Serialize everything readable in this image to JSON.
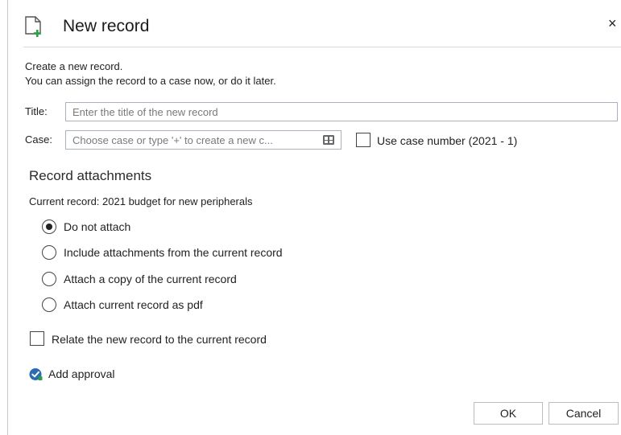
{
  "dialog": {
    "title": "New record",
    "close_label": "×"
  },
  "intro": {
    "line1": "Create a new record.",
    "line2": "You can assign the record to a case now, or do it later."
  },
  "form": {
    "title_label": "Title:",
    "title_placeholder": "Enter the title of the new record",
    "title_value": "",
    "case_label": "Case:",
    "case_placeholder": "Choose case or type '+' to create a new c...",
    "case_value": "",
    "use_case_number_label": "Use case number (2021 - 1)",
    "use_case_number_checked": false
  },
  "attachments": {
    "heading": "Record attachments",
    "current_record": "Current record: 2021 budget for new peripherals",
    "options": [
      {
        "label": "Do not attach",
        "checked": true
      },
      {
        "label": "Include attachments from the current record",
        "checked": false
      },
      {
        "label": "Attach a copy of the current record",
        "checked": false
      },
      {
        "label": "Attach current record as pdf",
        "checked": false
      }
    ]
  },
  "relate": {
    "label": "Relate the new record to the current record",
    "checked": false
  },
  "approval": {
    "label": "Add approval",
    "icon": "approval-icon"
  },
  "buttons": {
    "ok": "OK",
    "cancel": "Cancel"
  },
  "colors": {
    "accent_green": "#2e9e48",
    "approval_blue": "#2b6cb0",
    "border": "#aab3bd"
  }
}
